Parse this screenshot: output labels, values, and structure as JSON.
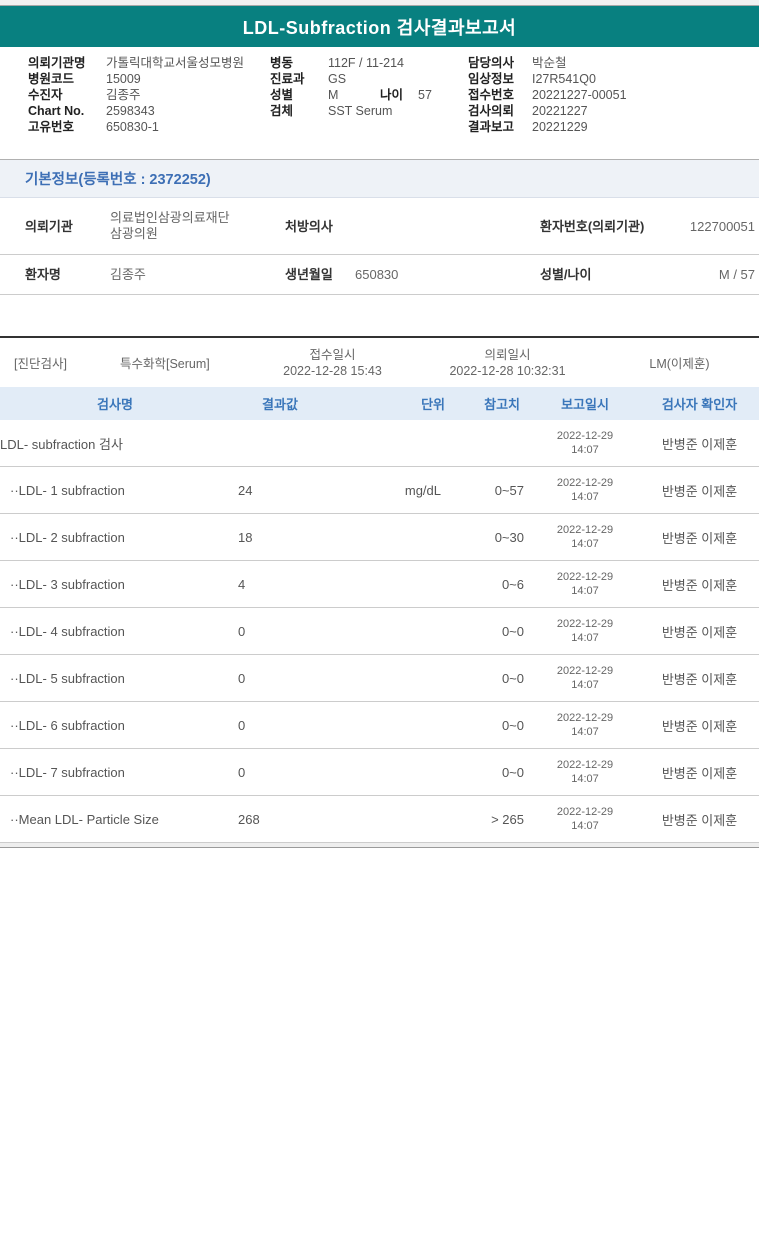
{
  "title": "LDL-Subfraction 검사결과보고서",
  "colors": {
    "header_teal": "#088080",
    "section_blue": "#3d6fb5",
    "table_header_bg": "#e2ecf7",
    "table_header_text": "#3a76ba"
  },
  "patient_info": {
    "col1": [
      {
        "label": "의뢰기관명",
        "value": "가톨릭대학교서울성모병원"
      },
      {
        "label": "병원코드",
        "value": "15009"
      },
      {
        "label": "수진자",
        "value": "김종주"
      },
      {
        "label": "Chart No.",
        "value": "2598343"
      },
      {
        "label": "고유번호",
        "value": "650830-1"
      }
    ],
    "col2": [
      {
        "label": "병동",
        "value": "112F / 11-214"
      },
      {
        "label": "진료과",
        "value": "GS"
      },
      {
        "label": "성별",
        "value": "M",
        "label2": "나이",
        "value2": "57"
      },
      {
        "label": "검체",
        "value": "SST Serum"
      }
    ],
    "col3": [
      {
        "label": "담당의사",
        "value": "박순철"
      },
      {
        "label": "임상정보",
        "value": "I27R541Q0"
      },
      {
        "label": "접수번호",
        "value": "20221227-00051"
      },
      {
        "label": "검사의뢰",
        "value": "20221227"
      },
      {
        "label": "결과보고",
        "value": "20221229"
      }
    ]
  },
  "basic_info": {
    "section_title": "기본정보(등록번호 : 2372252)",
    "row1": {
      "label1": "의뢰기관",
      "value1": "의료법인삼광의료재단삼광의원",
      "label2": "처방의사",
      "value2": "",
      "label3": "환자번호(의뢰기관)",
      "value3": "122700051"
    },
    "row2": {
      "label1": "환자명",
      "value1": "김종주",
      "label2": "생년월일",
      "value2": "650830",
      "label3": "성별/나이",
      "value3": "M / 57"
    }
  },
  "order_info": {
    "category": "[진단검사]",
    "test_group": "특수화학[Serum]",
    "receipt_label": "접수일시",
    "receipt_datetime": "2022-12-28  15:43",
    "request_label": "의뢰일시",
    "request_datetime": "2022-12-28  10:32:31",
    "department": "LM(이제훈)"
  },
  "results_table": {
    "headers": [
      "검사명",
      "결과값",
      "단위",
      "참고치",
      "보고일시",
      "검사자 확인자"
    ],
    "rows": [
      {
        "name": "LDL- subfraction 검사",
        "indent": false,
        "result": "",
        "unit": "",
        "reference": "",
        "report_date": "2022-12-29",
        "report_time": "14:07",
        "staff": "반병준 이제훈"
      },
      {
        "name": "··LDL- 1 subfraction",
        "indent": true,
        "result": "24",
        "unit": "mg/dL",
        "reference": "0~57",
        "report_date": "2022-12-29",
        "report_time": "14:07",
        "staff": "반병준 이제훈"
      },
      {
        "name": "··LDL- 2 subfraction",
        "indent": true,
        "result": "18",
        "unit": "",
        "reference": "0~30",
        "report_date": "2022-12-29",
        "report_time": "14:07",
        "staff": "반병준 이제훈"
      },
      {
        "name": "··LDL- 3 subfraction",
        "indent": true,
        "result": "4",
        "unit": "",
        "reference": "0~6",
        "report_date": "2022-12-29",
        "report_time": "14:07",
        "staff": "반병준 이제훈"
      },
      {
        "name": "··LDL- 4 subfraction",
        "indent": true,
        "result": "0",
        "unit": "",
        "reference": "0~0",
        "report_date": "2022-12-29",
        "report_time": "14:07",
        "staff": "반병준 이제훈"
      },
      {
        "name": "··LDL- 5 subfraction",
        "indent": true,
        "result": "0",
        "unit": "",
        "reference": "0~0",
        "report_date": "2022-12-29",
        "report_time": "14:07",
        "staff": "반병준 이제훈"
      },
      {
        "name": "··LDL- 6 subfraction",
        "indent": true,
        "result": "0",
        "unit": "",
        "reference": "0~0",
        "report_date": "2022-12-29",
        "report_time": "14:07",
        "staff": "반병준 이제훈"
      },
      {
        "name": "··LDL- 7 subfraction",
        "indent": true,
        "result": "0",
        "unit": "",
        "reference": "0~0",
        "report_date": "2022-12-29",
        "report_time": "14:07",
        "staff": "반병준 이제훈"
      },
      {
        "name": "··Mean LDL- Particle Size",
        "indent": true,
        "result": "268",
        "unit": "",
        "reference": "> 265",
        "report_date": "2022-12-29",
        "report_time": "14:07",
        "staff": "반병준 이제훈"
      }
    ]
  }
}
